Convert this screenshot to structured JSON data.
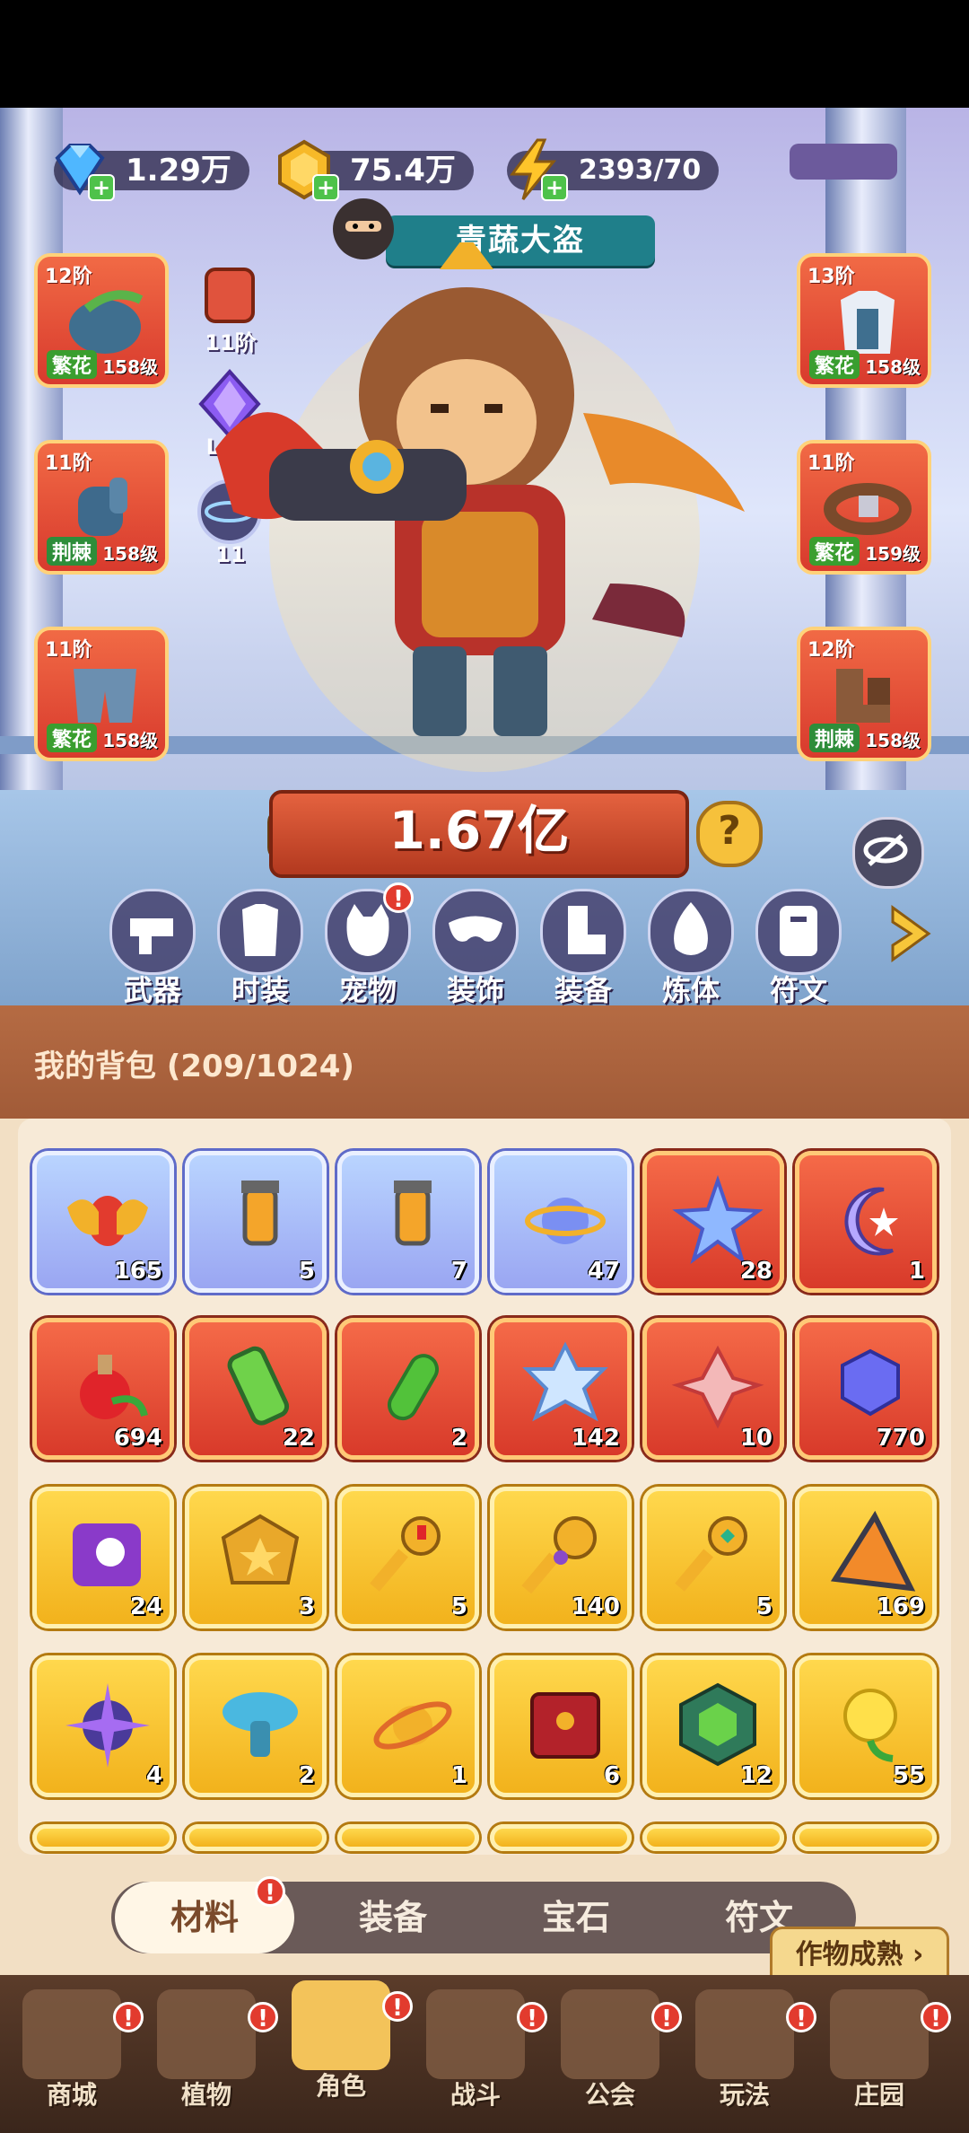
{
  "resources": {
    "diamonds": "1.29万",
    "gold": "75.4万",
    "energy": "2393/70"
  },
  "title": "青蔬大盗",
  "left_slots": [
    {
      "tier": "12阶",
      "grade": "繁花",
      "level": "158级"
    },
    {
      "tier": "11阶",
      "grade": "荆棘",
      "level": "158级"
    },
    {
      "tier": "11阶",
      "grade": "繁花",
      "level": "158级"
    }
  ],
  "right_slots": [
    {
      "tier": "13阶",
      "grade": "繁花",
      "level": "158级"
    },
    {
      "tier": "11阶",
      "grade": "繁花",
      "level": "159级"
    },
    {
      "tier": "12阶",
      "grade": "荆棘",
      "level": "158级"
    }
  ],
  "side_icons": {
    "rank_label": "11阶",
    "gem_label": "Lv.5",
    "orb_label": "11"
  },
  "power": "1.67亿",
  "help_symbol": "?",
  "categories": [
    "武器",
    "时装",
    "宠物",
    "装饰",
    "装备",
    "炼体",
    "符文"
  ],
  "bag": {
    "title": "我的背包 (209/1024)"
  },
  "items": [
    {
      "count": "165",
      "rarity": "purple",
      "icon": "scarab-icon"
    },
    {
      "count": "5",
      "rarity": "purple",
      "icon": "potion-vial-icon"
    },
    {
      "count": "7",
      "rarity": "purple",
      "icon": "potion-vial-icon"
    },
    {
      "count": "47",
      "rarity": "purple",
      "icon": "orbit-orb-icon"
    },
    {
      "count": "28",
      "rarity": "red",
      "icon": "star-crystal-icon"
    },
    {
      "count": "1",
      "rarity": "red",
      "icon": "moon-star-icon"
    },
    {
      "count": "694",
      "rarity": "red",
      "icon": "red-potion-icon"
    },
    {
      "count": "22",
      "rarity": "red",
      "icon": "green-tube-icon"
    },
    {
      "count": "2",
      "rarity": "red",
      "icon": "green-capsule-icon"
    },
    {
      "count": "142",
      "rarity": "red",
      "icon": "hexagram-crystal-icon"
    },
    {
      "count": "10",
      "rarity": "red",
      "icon": "knot-emblem-icon"
    },
    {
      "count": "770",
      "rarity": "red",
      "icon": "blue-cube-cluster-icon"
    },
    {
      "count": "24",
      "rarity": "gold",
      "icon": "skull-scroll-icon"
    },
    {
      "count": "3",
      "rarity": "gold",
      "icon": "golden-badge-icon"
    },
    {
      "count": "5",
      "rarity": "gold",
      "icon": "ruby-key-icon"
    },
    {
      "count": "140",
      "rarity": "gold",
      "icon": "ornate-key-icon"
    },
    {
      "count": "5",
      "rarity": "gold",
      "icon": "emerald-key-icon"
    },
    {
      "count": "169",
      "rarity": "gold",
      "icon": "pyramid-crystal-icon"
    },
    {
      "count": "4",
      "rarity": "gold",
      "icon": "star-compass-icon"
    },
    {
      "count": "2",
      "rarity": "gold",
      "icon": "blue-mushroom-icon"
    },
    {
      "count": "1",
      "rarity": "gold",
      "icon": "golden-orbit-icon"
    },
    {
      "count": "6",
      "rarity": "gold",
      "icon": "red-book-icon"
    },
    {
      "count": "12",
      "rarity": "gold",
      "icon": "green-cube-icon"
    },
    {
      "count": "55",
      "rarity": "gold",
      "icon": "yellow-rose-icon"
    }
  ],
  "tabs": [
    "材料",
    "装备",
    "宝石",
    "符文"
  ],
  "crop_tip": "作物成熟",
  "nav": [
    "商城",
    "植物",
    "角色",
    "战斗",
    "公会",
    "玩法",
    "庄园"
  ],
  "badge_mark": "!"
}
